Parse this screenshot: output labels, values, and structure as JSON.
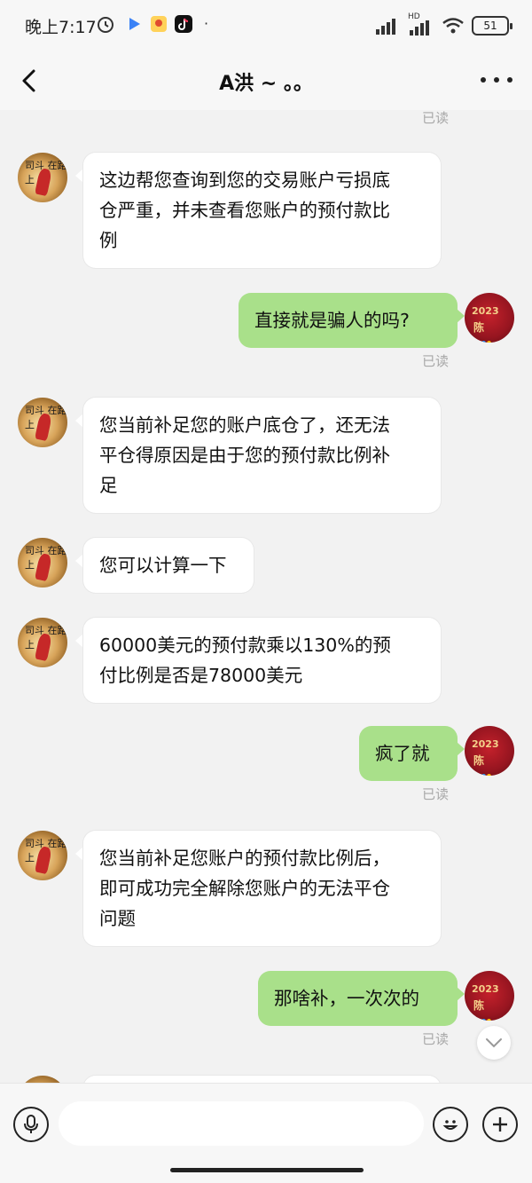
{
  "status_bar": {
    "time": "晚上7:17",
    "battery": "51",
    "network_label": "HD",
    "dot": "·"
  },
  "header": {
    "title": "A洪 ~ 。。"
  },
  "messages": [
    {
      "side": "left",
      "lines": [
        "这边帮您查询到您的交易账户亏损底",
        "仓严重，并未查看您账户的预付款比",
        "例"
      ]
    },
    {
      "side": "right",
      "lines": [
        "直接就是骗人的吗?"
      ],
      "read": "已读"
    },
    {
      "side": "left",
      "lines": [
        "您当前补足您的账户底仓了，还无法",
        "平仓得原因是由于您的预付款比例补",
        "足"
      ]
    },
    {
      "side": "left",
      "lines": [
        "您可以计算一下"
      ]
    },
    {
      "side": "left",
      "lines": [
        "60000美元的预付款乘以130%的预",
        "付比例是否是78000美元"
      ]
    },
    {
      "side": "right",
      "lines": [
        "疯了就"
      ],
      "read": "已读"
    },
    {
      "side": "left",
      "lines": [
        "您当前补足您账户的预付款比例后，",
        "即可成功完全解除您账户的无法平仓",
        "问题"
      ]
    },
    {
      "side": "right",
      "lines": [
        "那啥补，一次次的"
      ],
      "read": "已读"
    }
  ],
  "top_read": "已读",
  "avatars": {
    "left_text": "司斗 在路上",
    "right_year": "2023",
    "right_name": "陈"
  },
  "input": {
    "placeholder": ""
  },
  "colors": {
    "bubble_right": "#a9e08a",
    "bubble_left": "#ffffff",
    "background": "#f2f2f2"
  }
}
